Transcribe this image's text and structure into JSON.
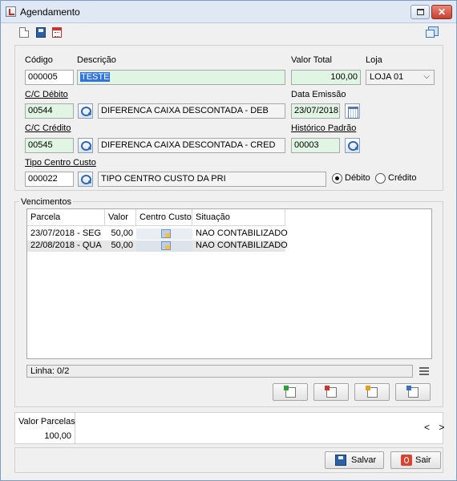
{
  "window": {
    "title": "Agendamento"
  },
  "form": {
    "codigo": {
      "label": "Código",
      "value": "000005"
    },
    "descricao": {
      "label": "Descrição",
      "value": "TESTE"
    },
    "valor_total": {
      "label": "Valor Total",
      "value": "100,00"
    },
    "loja": {
      "label": "Loja",
      "value": "LOJA 01"
    },
    "cc_debito": {
      "label": "C/C Débito",
      "code": "00544",
      "desc": "DIFERENCA CAIXA DESCONTADA - DEB"
    },
    "data_emissao": {
      "label": "Data Emissão",
      "value": "23/07/2018"
    },
    "cc_credito": {
      "label": "C/C Crédito",
      "code": "00545",
      "desc": "DIFERENCA CAIXA DESCONTADA - CRED"
    },
    "historico_padrao": {
      "label": "Histórico Padrão",
      "value": "00003"
    },
    "tipo_centro_custo": {
      "label": "Tipo Centro Custo",
      "code": "000022",
      "desc": "TIPO CENTRO CUSTO DA  PRI"
    },
    "radio_debito": "Débito",
    "radio_credito": "Crédito",
    "selected_radio": "Débito"
  },
  "vencimentos": {
    "legend": "Vencimentos",
    "columns": [
      "Parcela",
      "Valor",
      "Centro Custo",
      "Situação"
    ],
    "rows": [
      {
        "parcela": "23/07/2018 - SEG",
        "valor": "50,00",
        "situacao": "NAO CONTABILIZADO"
      },
      {
        "parcela": "22/08/2018 - QUA",
        "valor": "50,00",
        "situacao": "NAO CONTABILIZADO"
      }
    ],
    "linha": "Linha: 0/2"
  },
  "valor_parcelas": {
    "label": "Valor Parcelas",
    "value": "100,00"
  },
  "nav": "< >",
  "buttons": {
    "salvar": "Salvar",
    "sair": "Sair"
  },
  "colors": {
    "field_green": "#e0f5e3",
    "selection": "#3374d8",
    "close_red": "#c7402f"
  }
}
